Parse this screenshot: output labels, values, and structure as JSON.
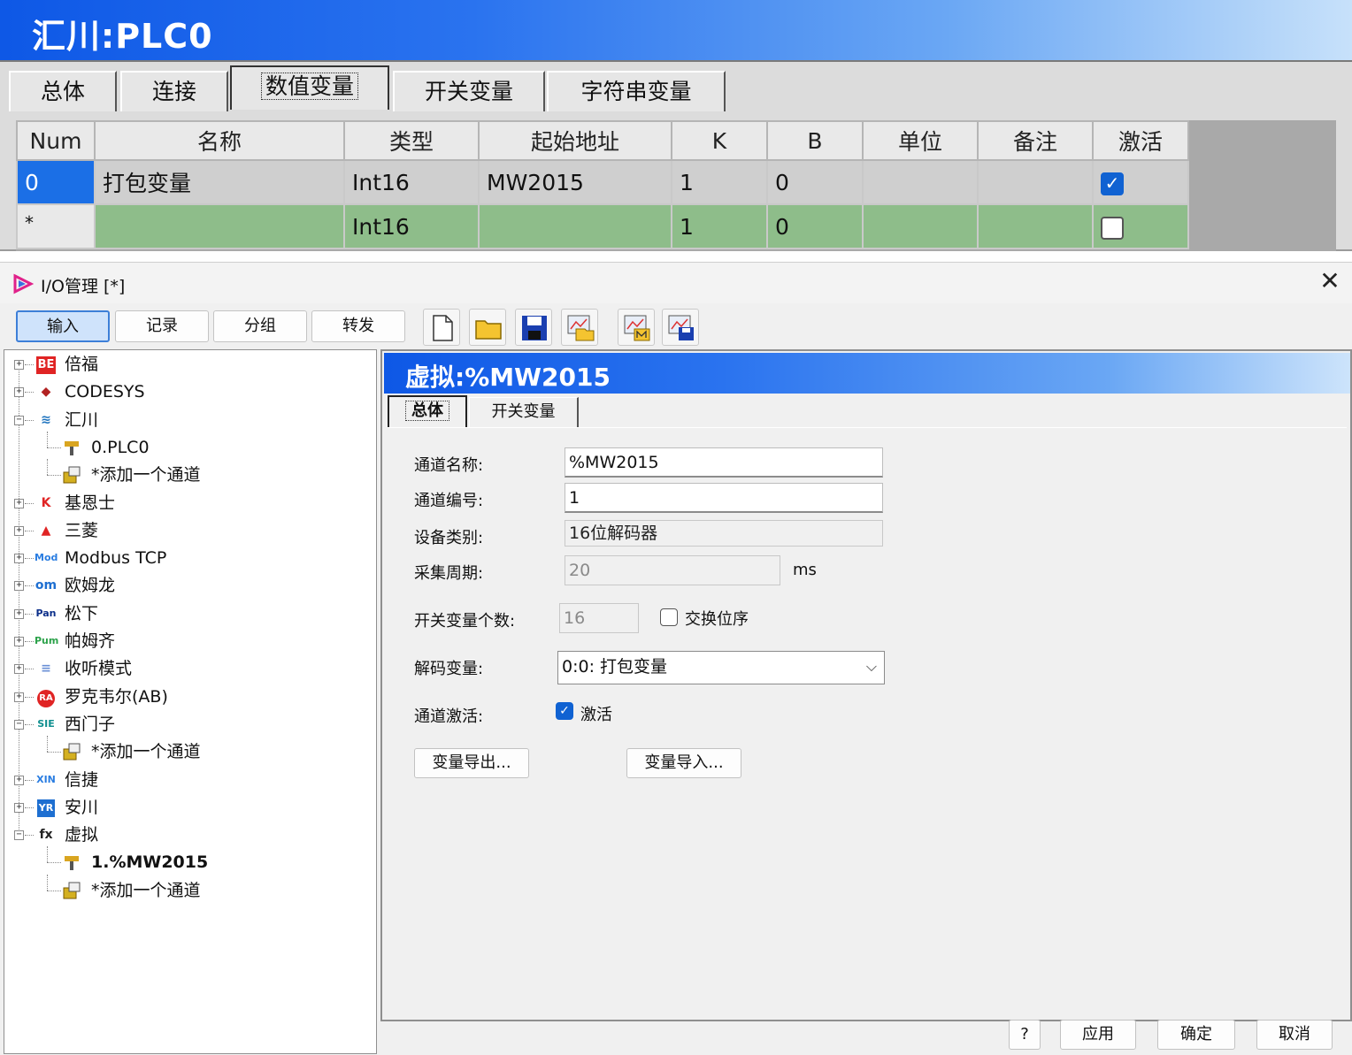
{
  "top": {
    "title": "汇川:PLC0",
    "tabs": [
      "总体",
      "连接",
      "数值变量",
      "开关变量",
      "字符串变量"
    ],
    "columns": [
      "Num",
      "名称",
      "类型",
      "起始地址",
      "K",
      "B",
      "单位",
      "备注",
      "激活"
    ],
    "rows": [
      {
        "num": "0",
        "name": "打包变量",
        "type": "Int16",
        "addr": "MW2015",
        "k": "1",
        "b": "0",
        "unit": "",
        "note": "",
        "active": true
      },
      {
        "num": "*",
        "name": "",
        "type": "Int16",
        "addr": "",
        "k": "1",
        "b": "0",
        "unit": "",
        "note": "",
        "active": false
      }
    ]
  },
  "window": {
    "title": "I/O管理 [*]",
    "nav": [
      "输入",
      "记录",
      "分组",
      "转发"
    ],
    "tree": [
      {
        "label": "倍福",
        "icon": "BE",
        "icon_color": "#e02424"
      },
      {
        "label": "CODESYS",
        "icon": "◆",
        "icon_color": "#b22222"
      },
      {
        "label": "汇川",
        "icon": "≋",
        "icon_color": "#1e73be"
      },
      {
        "label": "0.PLC0",
        "icon": "plc"
      },
      {
        "label": "*添加一个通道",
        "icon": "add"
      },
      {
        "label": "基恩士",
        "icon": "K",
        "icon_color": "#e02424"
      },
      {
        "label": "三菱",
        "icon": "▲",
        "icon_color": "#e02424"
      },
      {
        "label": "Modbus TCP",
        "icon": "Mod",
        "icon_color": "#2a7de1"
      },
      {
        "label": "欧姆龙",
        "icon": "om",
        "icon_color": "#1e6fd1"
      },
      {
        "label": "松下",
        "icon": "Pan",
        "icon_color": "#0b2f8a"
      },
      {
        "label": "帕姆齐",
        "icon": "Pum",
        "icon_color": "#2ca24a"
      },
      {
        "label": "收听模式",
        "icon": "≡",
        "icon_color": "#6a8fd6"
      },
      {
        "label": "罗克韦尔(AB)",
        "icon": "RA",
        "icon_color": "#e02424"
      },
      {
        "label": "西门子",
        "icon": "SIE",
        "icon_color": "#0f8f8f"
      },
      {
        "label": "*添加一个通道",
        "icon": "add"
      },
      {
        "label": "信捷",
        "icon": "XIN",
        "icon_color": "#2a7de1"
      },
      {
        "label": "安川",
        "icon": "YR",
        "icon_color": "#1e6fd1"
      },
      {
        "label": "虚拟",
        "icon": "fx",
        "icon_color": "#222"
      },
      {
        "label": "1.%MW2015",
        "icon": "plc"
      },
      {
        "label": "*添加一个通道",
        "icon": "add"
      }
    ],
    "detail": {
      "title": "虚拟:%MW2015",
      "tabs": [
        "总体",
        "开关变量"
      ],
      "channel_name_label": "通道名称:",
      "channel_name_value": "%MW2015",
      "channel_no_label": "通道编号:",
      "channel_no_value": "1",
      "device_type_label": "设备类别:",
      "device_type_value": "16位解码器",
      "period_label": "采集周期:",
      "period_value": "20",
      "period_unit": "ms",
      "switch_count_label": "开关变量个数:",
      "switch_count_value": "16",
      "swap_label": "交换位序",
      "decode_label": "解码变量:",
      "decode_value": "0:0: 打包变量",
      "activate_label": "通道激活:",
      "activate_text": "激活",
      "export_btn": "变量导出...",
      "import_btn": "变量导入..."
    },
    "footer": [
      "?",
      "应用",
      "确定",
      "取消"
    ]
  }
}
